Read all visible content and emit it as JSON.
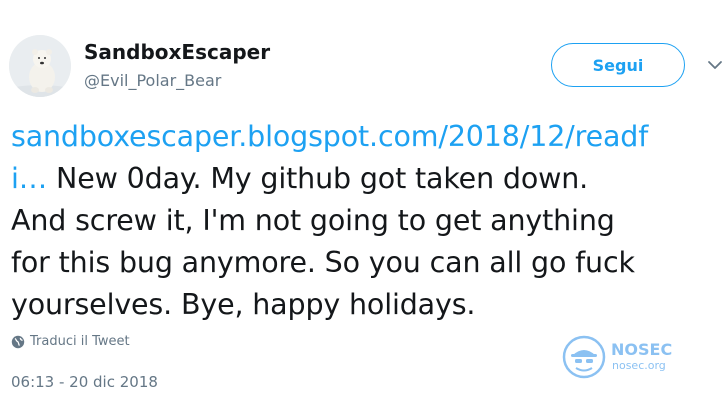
{
  "author": {
    "name": "SandboxEscaper",
    "handle": "@Evil_Polar_Bear",
    "avatar_icon": "polar-bear-avatar"
  },
  "follow_button": {
    "label": "Segui"
  },
  "menu": {
    "icon": "chevron-down-icon"
  },
  "tweet": {
    "link_line1": "sandboxescaper.blogspot.com/2018/12/readf",
    "link_line2": "i…",
    "text_line2": " New 0day. My github got taken down.",
    "text_line3": "And screw it, I'm not going to get anything",
    "text_line4": "for this bug anymore. So you can all go fuck",
    "text_line5": "yourselves. Bye, happy holidays."
  },
  "translate": {
    "label": "Traduci il Tweet",
    "icon": "globe-icon"
  },
  "watermark": {
    "title": "NOSEC",
    "subtitle": "nosec.org"
  },
  "timestamp": "06:13 - 20 dic 2018",
  "colors": {
    "accent": "#1da1f2",
    "text": "#14171a",
    "muted": "#657786"
  }
}
